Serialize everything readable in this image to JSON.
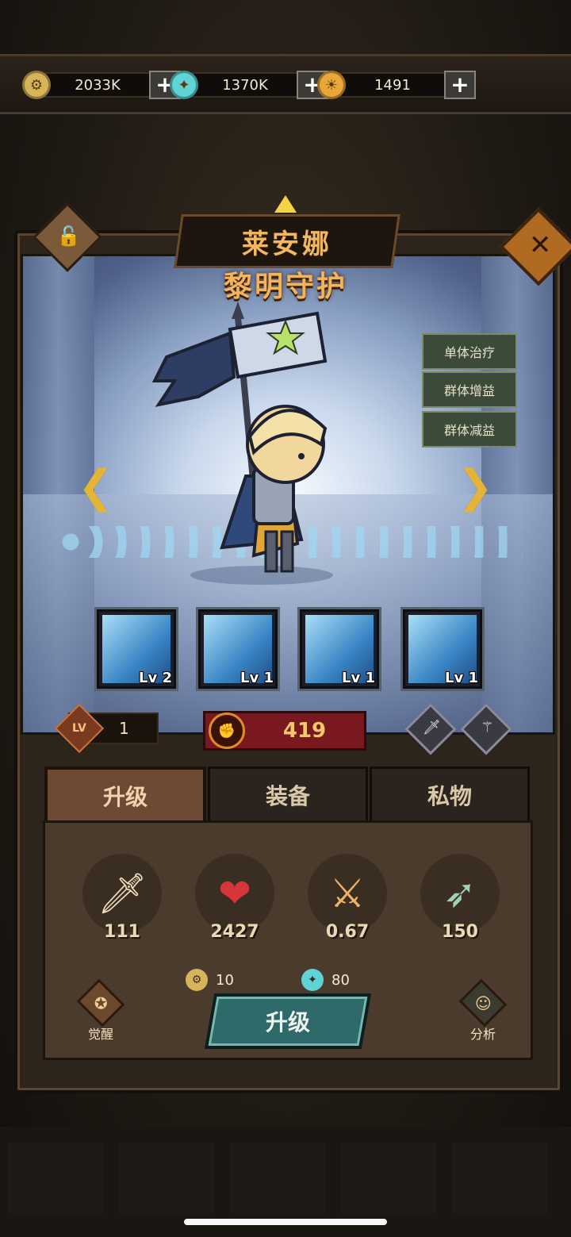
{
  "resources": [
    {
      "icon": "gold-coin-icon",
      "symbol": "⚙",
      "color": "#d7b45a",
      "amount": "2033K"
    },
    {
      "icon": "spirit-gem-icon",
      "symbol": "✦",
      "color": "#5fd3d6",
      "amount": "1370K"
    },
    {
      "icon": "rune-token-icon",
      "symbol": "☀",
      "color": "#e9a73a",
      "amount": "1491"
    }
  ],
  "plus_label": "+",
  "hero": {
    "name": "莱安娜",
    "title": "黎明守护",
    "tags": [
      "单体治疗",
      "群体增益",
      "群体减益"
    ],
    "level_label": "LV",
    "level": "1",
    "power": "419"
  },
  "skills": [
    {
      "label": "Lv 2"
    },
    {
      "label": "Lv 1"
    },
    {
      "label": "Lv 1"
    },
    {
      "label": "Lv 1"
    }
  ],
  "tabs": [
    {
      "label": "升级",
      "active": true
    },
    {
      "label": "装备",
      "active": false
    },
    {
      "label": "私物",
      "active": false
    }
  ],
  "stats": [
    {
      "icon": "attack-sword-icon",
      "symbol": "🗡",
      "value": "111"
    },
    {
      "icon": "health-heart-icon",
      "symbol": "❤",
      "value": "2427"
    },
    {
      "icon": "attack-speed-icon",
      "symbol": "⚔",
      "value": "0.67"
    },
    {
      "icon": "range-arrow-icon",
      "symbol": "➶",
      "value": "150"
    }
  ],
  "costs": [
    {
      "icon": "gold-coin-icon",
      "value": "10"
    },
    {
      "icon": "spirit-gem-icon",
      "value": "80"
    }
  ],
  "upgrade_button": "升级",
  "awaken_label": "觉醒",
  "analyze_label": "分析"
}
